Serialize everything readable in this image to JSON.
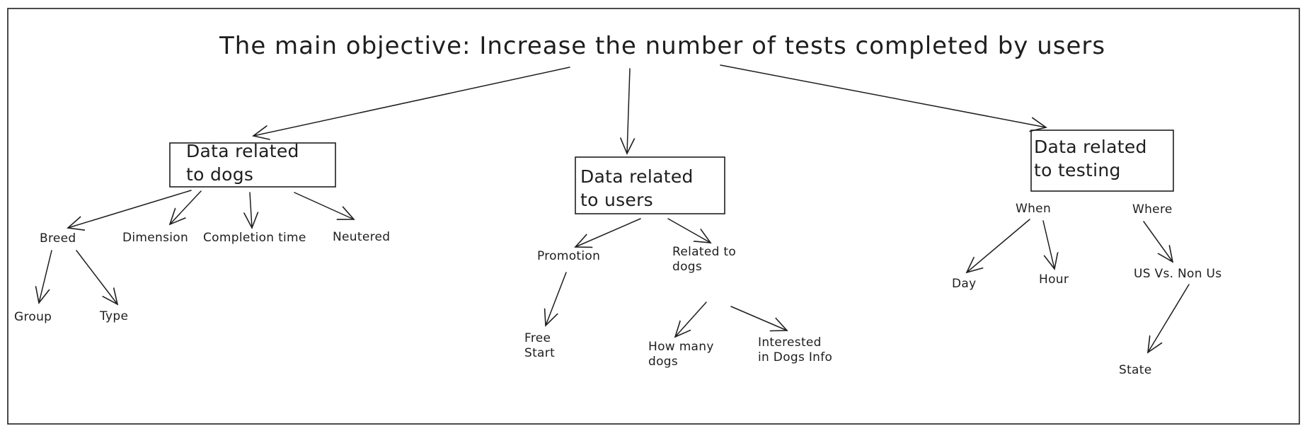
{
  "title": "The main objective: Increase the number of tests completed by users",
  "boxes": {
    "dogs": "Data related\nto dogs",
    "users": "Data related\nto users",
    "testing": "Data related\nto testing"
  },
  "labels": {
    "breed": "Breed",
    "dimension": "Dimension",
    "completion_time": "Completion time",
    "neutered": "Neutered",
    "group": "Group",
    "type": "Type",
    "promotion": "Promotion",
    "related_to_dogs": "Related to\ndogs",
    "free_start": "Free\nStart",
    "how_many_dogs": "How many\ndogs",
    "interested": "Interested\nin Dogs Info",
    "when": "When",
    "where": "Where",
    "day": "Day",
    "hour": "Hour",
    "us_vs_non_us": "US Vs. Non Us",
    "state": "State"
  },
  "colors": {
    "stroke": "#1e1e1e",
    "background": "#ffffff"
  }
}
